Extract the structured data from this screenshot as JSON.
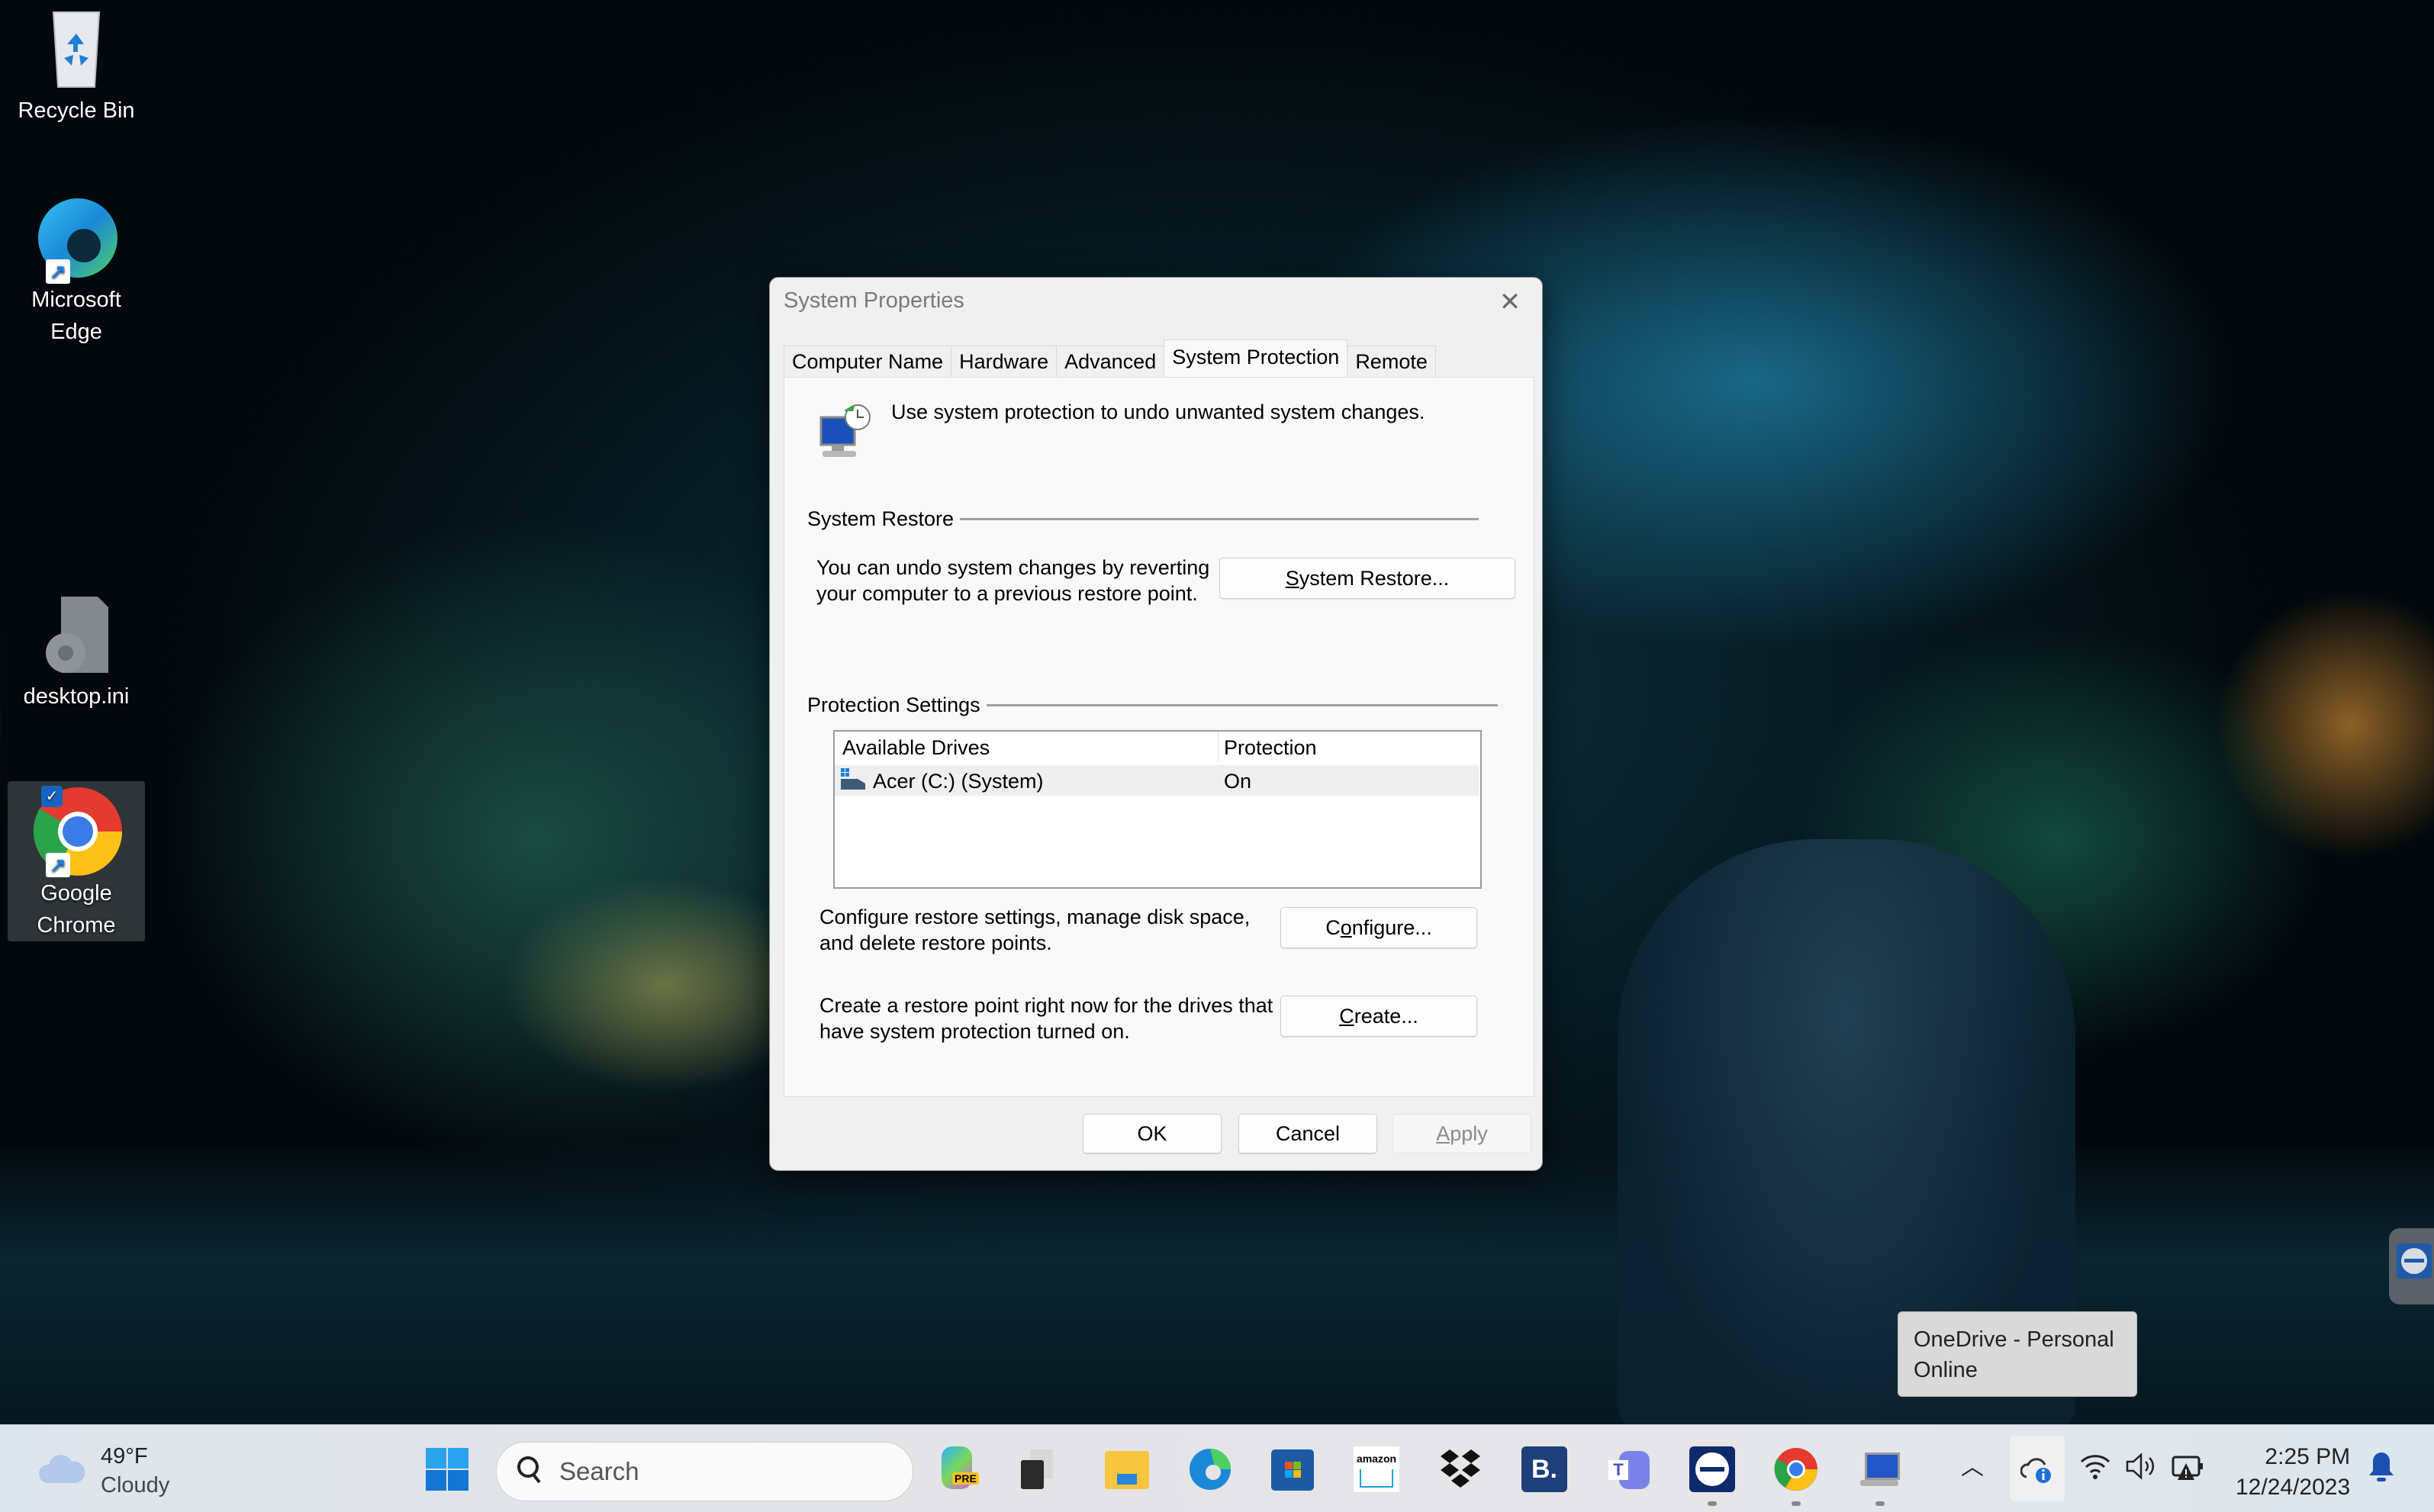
{
  "desktop": {
    "icons": [
      {
        "label": "Recycle Bin",
        "icon": "recycle-bin-icon"
      },
      {
        "label": "Microsoft Edge",
        "icon": "edge-icon",
        "shortcut": true
      },
      {
        "label": "desktop.ini",
        "icon": "settings-file-icon"
      },
      {
        "label": "Google Chrome",
        "icon": "chrome-icon",
        "shortcut": true,
        "selected": true
      }
    ]
  },
  "dialog": {
    "title": "System Properties",
    "tabs": [
      {
        "label": "Computer Name",
        "active": false
      },
      {
        "label": "Hardware",
        "active": false
      },
      {
        "label": "Advanced",
        "active": false
      },
      {
        "label": "System Protection",
        "active": true
      },
      {
        "label": "Remote",
        "active": false
      }
    ],
    "intro": "Use system protection to undo unwanted system changes.",
    "system_restore": {
      "group_label": "System Restore",
      "description_line1": "You can undo system changes by reverting",
      "description_line2": "your computer to a previous restore point.",
      "button_mnemonic": "S",
      "button_rest": "ystem Restore..."
    },
    "protection_settings": {
      "group_label": "Protection Settings",
      "columns": [
        "Available Drives",
        "Protection"
      ],
      "rows": [
        {
          "drive": "Acer (C:) (System)",
          "protection": "On"
        }
      ],
      "configure_desc_line1": "Configure restore settings, manage disk space,",
      "configure_desc_line2": "and delete restore points.",
      "configure_pre": "C",
      "configure_mnemonic": "o",
      "configure_rest": "nfigure...",
      "create_desc_line1": "Create a restore point right now for the drives that",
      "create_desc_line2": "have system protection turned on.",
      "create_mnemonic": "C",
      "create_rest": "reate..."
    },
    "footer": {
      "ok": "OK",
      "cancel": "Cancel",
      "apply_mnemonic": "A",
      "apply_rest": "pply",
      "apply_enabled": false
    }
  },
  "tooltip": {
    "line1": "OneDrive - Personal",
    "line2": "Online"
  },
  "taskbar": {
    "weather": {
      "temp": "49°F",
      "condition": "Cloudy"
    },
    "search_placeholder": "Search",
    "pinned": [
      {
        "name": "copilot-pre-icon",
        "badge": "PRE",
        "running": false
      },
      {
        "name": "task-view-icon",
        "running": false
      },
      {
        "name": "file-explorer-icon",
        "running": false
      },
      {
        "name": "edge-icon",
        "running": false
      },
      {
        "name": "microsoft-store-icon",
        "running": false
      },
      {
        "name": "amazon-icon",
        "label": "amazon",
        "running": false
      },
      {
        "name": "dropbox-icon",
        "running": false
      },
      {
        "name": "booking-icon",
        "label": "B.",
        "running": false
      },
      {
        "name": "teams-icon",
        "label": "T",
        "running": false
      },
      {
        "name": "teamviewer-icon",
        "running": true
      },
      {
        "name": "chrome-icon",
        "running": true
      },
      {
        "name": "system-properties-icon",
        "running": true
      }
    ],
    "clock": {
      "time": "2:25 PM",
      "date": "12/24/2023"
    }
  },
  "colors": {
    "accent": "#0067c0",
    "tooltip_bg": "#d9d9d9",
    "dialog_bg": "#f0f0f0"
  }
}
